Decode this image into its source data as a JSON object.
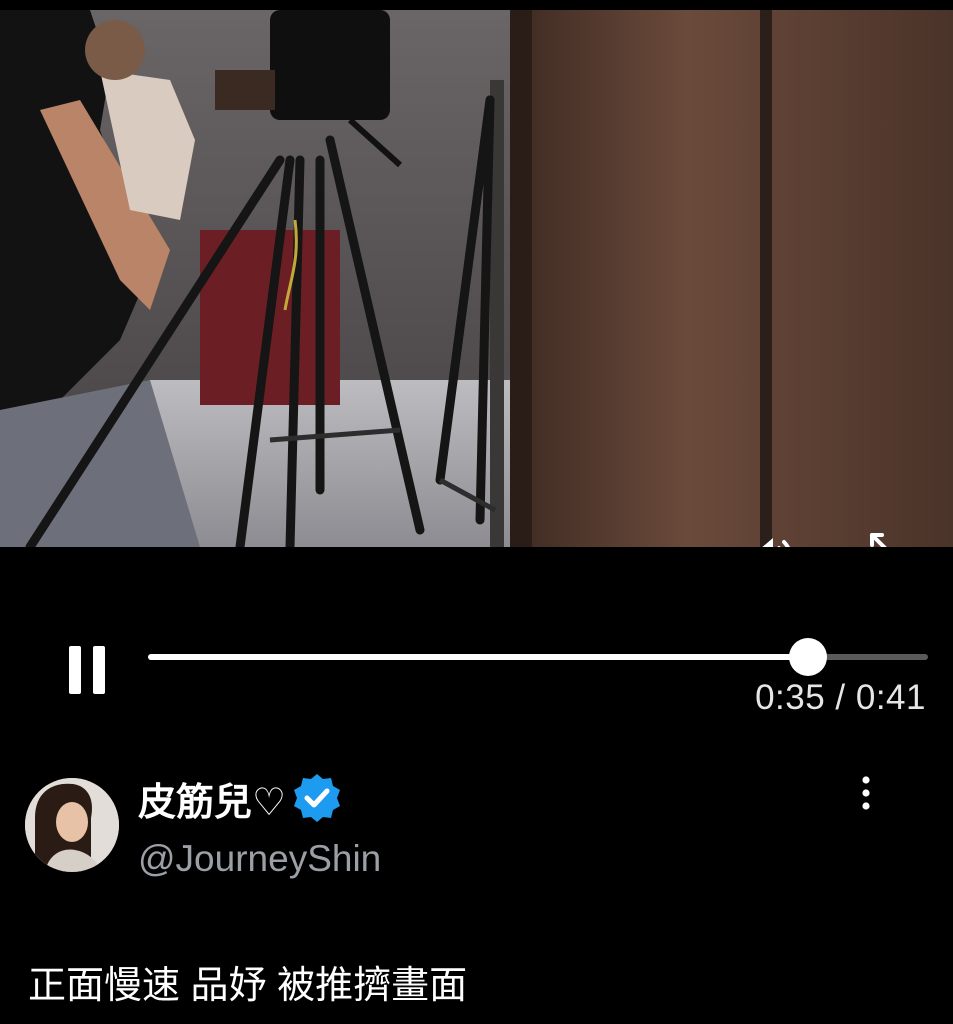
{
  "video": {
    "volume_icon": "volume-up-icon",
    "pip_icon": "picture-in-picture-icon"
  },
  "playback": {
    "state_icon": "pause-icon",
    "progress": 0.846,
    "time_text": "0:35 / 0:41"
  },
  "author": {
    "display_name": "皮筋兒♡",
    "verified": true,
    "badge_icon": "verified-badge-icon",
    "handle": "@JourneyShin",
    "more_icon": "more-vertical-icon"
  },
  "post": {
    "text": "正面慢速 品妤 被推擠畫面"
  },
  "colors": {
    "background": "#000000",
    "verified": "#1d9bf0",
    "handle": "#9aa0a6",
    "track": "#5a5a5a",
    "progress": "#ffffff"
  }
}
